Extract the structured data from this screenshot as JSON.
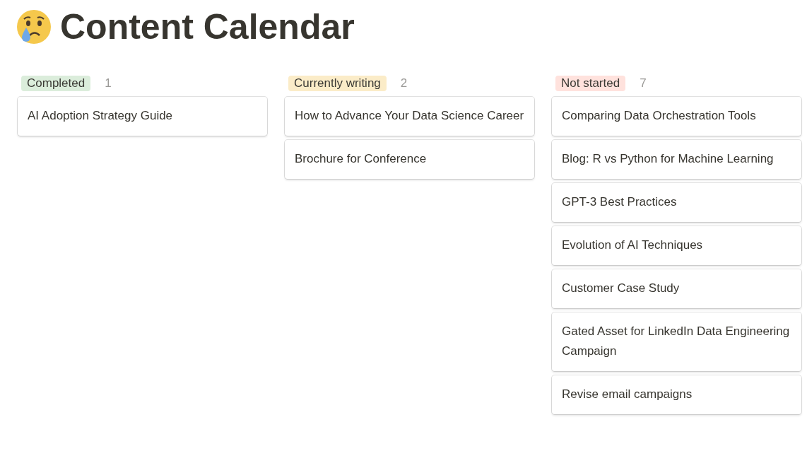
{
  "page": {
    "title": "Content Calendar"
  },
  "columns": [
    {
      "status": "Completed",
      "color": "#dbeddb",
      "count": "1",
      "cards": [
        "AI Adoption Strategy Guide"
      ]
    },
    {
      "status": "Currently writing",
      "color": "#fbecc8",
      "count": "2",
      "cards": [
        "How to Advance Your Data Science Career",
        "Brochure for Conference"
      ]
    },
    {
      "status": "Not started",
      "color": "#ffe2dd",
      "count": "7",
      "cards": [
        "Comparing Data Orchestration Tools",
        "Blog: R vs Python for Machine Learning",
        "GPT-3 Best Practices",
        "Evolution of AI Techniques",
        "Customer Case Study",
        "Gated Asset for LinkedIn Data Engineering Campaign",
        "Revise email campaigns"
      ]
    }
  ]
}
